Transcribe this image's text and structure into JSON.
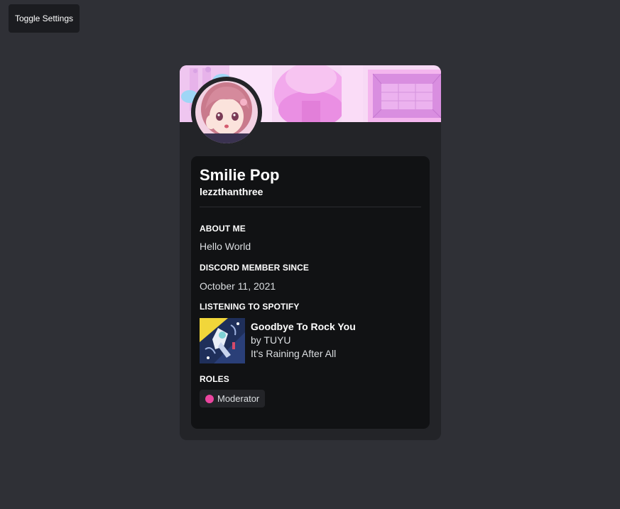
{
  "toolbar": {
    "toggle_settings_label": "Toggle Settings"
  },
  "profile": {
    "display_name": "Smilie Pop",
    "username": "lezzthanthree",
    "avatar_icon": "anime-avatar",
    "banner_icon": "pastel-pink-room-banner"
  },
  "sections": {
    "about_me": {
      "title": "About Me",
      "text": "Hello World"
    },
    "member_since": {
      "title": "Discord Member Since",
      "text": "October 11, 2021"
    },
    "spotify": {
      "title": "Listening to Spotify",
      "track": "Goodbye To Rock You",
      "artist_line": "by TUYU",
      "album": "It's Raining After All",
      "album_art_icon": "album-cover-art"
    },
    "roles": {
      "title": "Roles",
      "items": [
        {
          "name": "Moderator",
          "color": "#eb459f"
        }
      ]
    }
  },
  "colors": {
    "page_background": "#2f3036",
    "card_background": "#232428",
    "inner_background": "#111214",
    "accent_pink": "#eb459f"
  }
}
